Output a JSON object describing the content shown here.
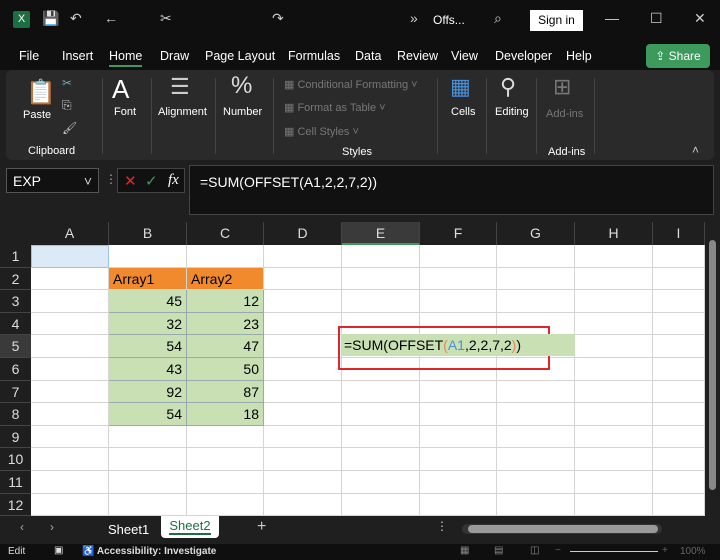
{
  "titlebar": {
    "filename": "Offs...",
    "more": "»",
    "sign_in": "Sign in"
  },
  "menu": {
    "tabs": [
      "File",
      "Insert",
      "Home",
      "Draw",
      "Page Layout",
      "Formulas",
      "Data",
      "Review",
      "View",
      "Developer",
      "Help"
    ],
    "active": "Home",
    "share": "Share"
  },
  "ribbon": {
    "paste": "Paste",
    "clipboard": "Clipboard",
    "font": "Font",
    "alignment": "Alignment",
    "number": "Number",
    "conditional_formatting": "Conditional Formatting",
    "format_as_table": "Format as Table",
    "cell_styles": "Cell Styles",
    "styles": "Styles",
    "cells": "Cells",
    "editing": "Editing",
    "addins_btn": "Add-ins",
    "addins_group": "Add-ins"
  },
  "formula_bar": {
    "name_box": "EXP",
    "fx": "fx",
    "formula": "=SUM(OFFSET(A1,2,2,7,2))"
  },
  "columns": [
    "A",
    "B",
    "C",
    "D",
    "E",
    "F",
    "G",
    "H",
    "I"
  ],
  "rows": [
    "1",
    "2",
    "3",
    "4",
    "5",
    "6",
    "7",
    "8",
    "9",
    "10",
    "11",
    "12"
  ],
  "table": {
    "headers": [
      "Array1",
      "Array2"
    ],
    "array1": [
      "45",
      "32",
      "54",
      "43",
      "92",
      "54"
    ],
    "array2": [
      "12",
      "23",
      "47",
      "50",
      "87",
      "18"
    ]
  },
  "edit_cell": {
    "p1": "=SUM(OFFSET",
    "p2": "(",
    "ref": "A1",
    "p3": ",2,2,7,2",
    "p4": ")",
    "p5": ")"
  },
  "sheets": [
    "Sheet1",
    "Sheet2"
  ],
  "active_sheet": "Sheet2",
  "status": {
    "mode": "Edit",
    "accessibility": "Accessibility: Investigate",
    "zoom": "100%"
  },
  "colors": {
    "header": "#f08a2c",
    "data": "#c8e0b4",
    "highlight": "#e0262b",
    "accent": "#3c9a5c"
  }
}
